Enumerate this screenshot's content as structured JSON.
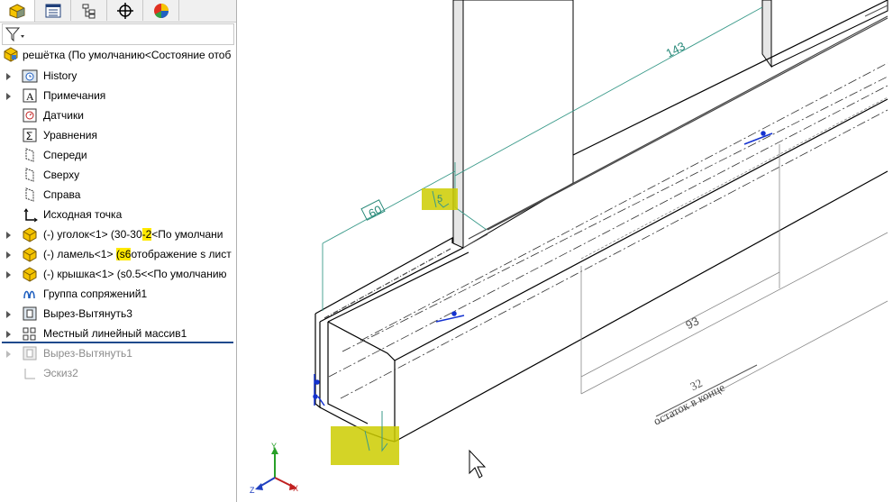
{
  "tabs": [
    {
      "name": "featuremanager-tab",
      "icon": "cube-icon"
    },
    {
      "name": "propertymanager-tab",
      "icon": "list-icon"
    },
    {
      "name": "configurationmanager-tab",
      "icon": "config-icon"
    },
    {
      "name": "dimxpert-tab",
      "icon": "crosshair-icon"
    },
    {
      "name": "display-manager-tab",
      "icon": "color-pie-icon"
    }
  ],
  "root": {
    "label": "решётка  (По умолчанию<Состояние отоб"
  },
  "tree": [
    {
      "label": "History",
      "icon": "history-folder-icon",
      "expandable": true
    },
    {
      "label": "Примечания",
      "icon": "annotations-icon",
      "expandable": true
    },
    {
      "label": "Датчики",
      "icon": "sensors-icon",
      "expandable": false
    },
    {
      "label": "Уравнения",
      "icon": "equations-icon",
      "expandable": false
    },
    {
      "label": "Спереди",
      "icon": "plane-icon",
      "expandable": false
    },
    {
      "label": "Сверху",
      "icon": "plane-icon",
      "expandable": false
    },
    {
      "label": "Справа",
      "icon": "plane-icon",
      "expandable": false
    },
    {
      "label": "Исходная точка",
      "icon": "origin-icon",
      "expandable": false
    },
    {
      "label_a": "(-) уголок<1> (30-30",
      "label_hl": "-2",
      "label_b": "<По умолчани",
      "icon": "part-icon",
      "expandable": true
    },
    {
      "label_a": "(-) ламель<1> ",
      "label_hl": "(s6",
      "label_b": "отображение s лист",
      "icon": "part-icon",
      "expandable": true
    },
    {
      "label": "(-) крышка<1> (s0.5<<По умолчанию",
      "icon": "part-icon",
      "expandable": true
    },
    {
      "label": "Группа сопряжений1",
      "icon": "mates-icon",
      "expandable": false
    },
    {
      "label": "Вырез-Вытянуть3",
      "icon": "cut-extrude-icon",
      "expandable": true
    },
    {
      "label": "Местный линейный массив1",
      "icon": "linear-pattern-icon",
      "expandable": true
    },
    {
      "label": "Вырез-Вытянуть1",
      "icon": "cut-extrude-icon",
      "expandable": true,
      "suppressed": true
    },
    {
      "label": "Эскиз2",
      "icon": "sketch-icon",
      "expandable": false,
      "suppressed": true
    }
  ],
  "dimensions": {
    "d143": "143",
    "d60": "60",
    "d5": "5",
    "d93": "93",
    "d32": "32",
    "note": "остаток в конце"
  },
  "triad": {
    "x": "X",
    "y": "Y",
    "z": "Z"
  },
  "colors": {
    "accent_blue": "#1f4a8c",
    "dimension_green": "#3a9a8a",
    "highlight_yellow": "#ffe900",
    "viewport_bg": "#ffffff"
  }
}
